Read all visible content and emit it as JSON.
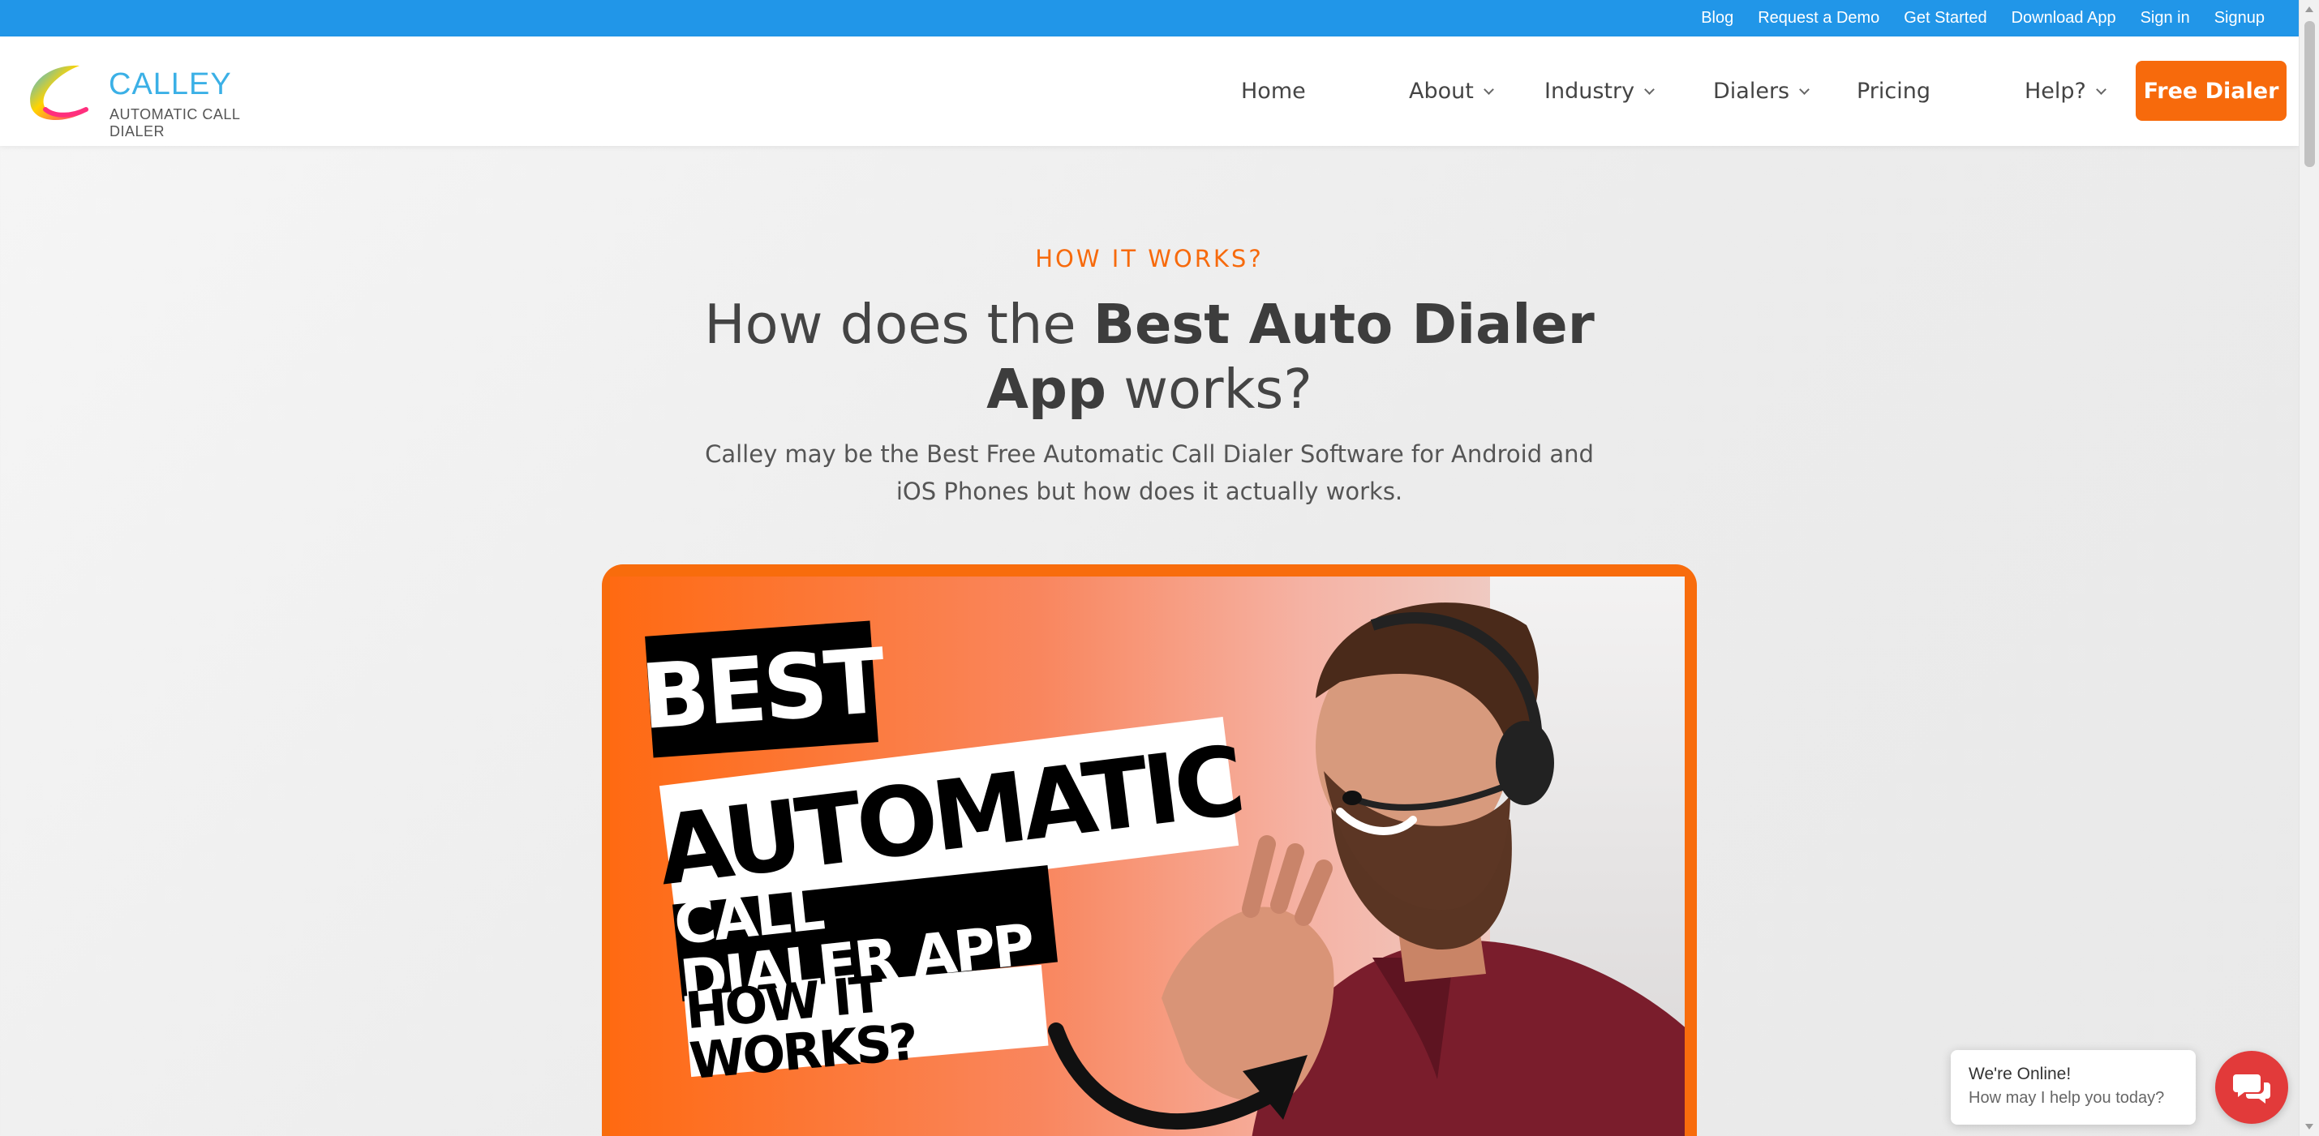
{
  "topbar": {
    "links": [
      "Blog",
      "Request a Demo",
      "Get Started",
      "Download App",
      "Sign in",
      "Signup"
    ]
  },
  "header": {
    "logo_word": "CALLEY",
    "logo_tagline": "AUTOMATIC CALL DIALER",
    "nav": {
      "home": "Home",
      "about": "About",
      "industry": "Industry",
      "dialers": "Dialers",
      "pricing": "Pricing",
      "help": "Help?"
    },
    "cta": "Free Dialer"
  },
  "section": {
    "eyebrow": "HOW IT WORKS?",
    "headline_pre": "How does the ",
    "headline_bold": "Best Auto Dialer App",
    "headline_post": " works?",
    "subtext": "Calley may be the Best Free Automatic Call Dialer Software for Android and iOS Phones but how does it actually works."
  },
  "video": {
    "line1": "BEST",
    "line2": "AUTOMATIC",
    "line3": "CALL DIALER APP",
    "line4": "HOW IT WORKS?"
  },
  "chat": {
    "title": "We're Online!",
    "subtitle": "How may I help you today?",
    "icon": "chat-icon"
  },
  "colors": {
    "topbar": "#2196e8",
    "accent": "#f76a0c",
    "chat_button": "#e23a3a"
  }
}
